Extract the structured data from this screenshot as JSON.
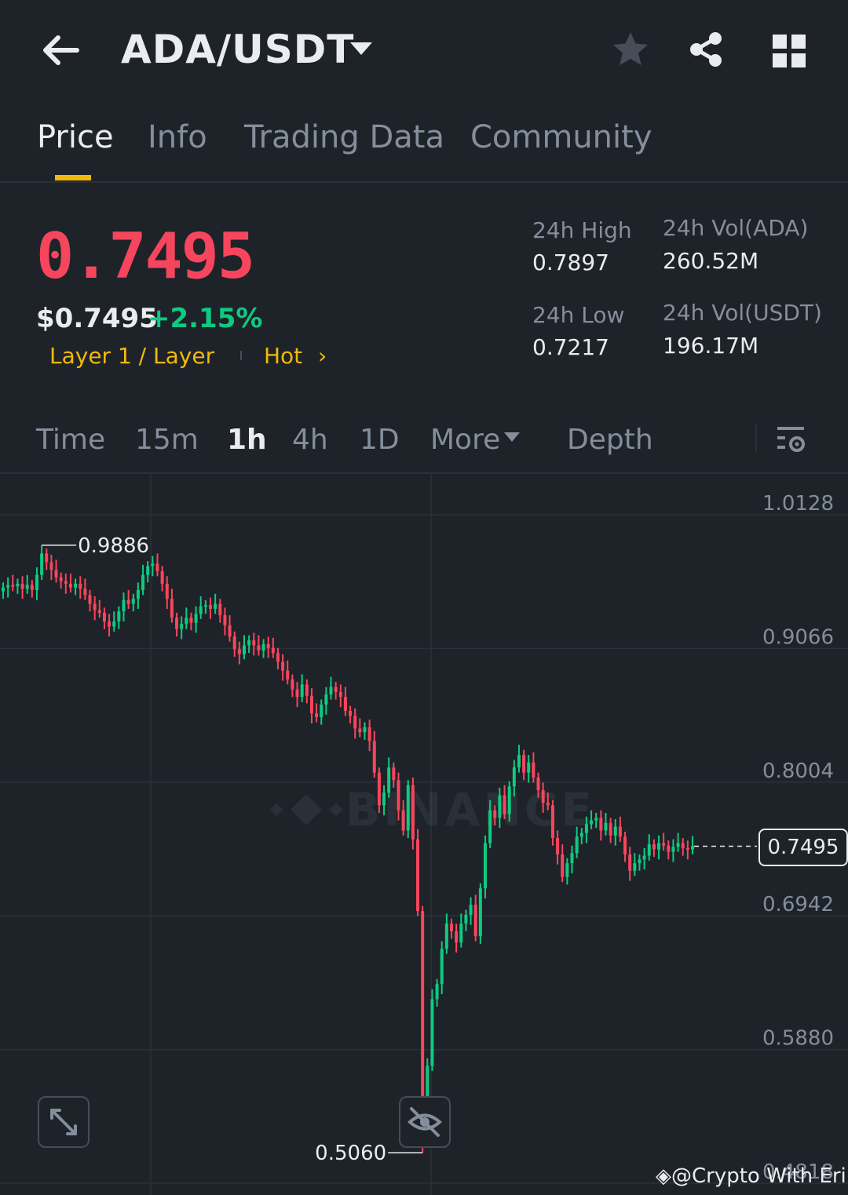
{
  "header": {
    "pair": "ADA/USDT",
    "icons": {
      "back": "arrow-left-icon",
      "favorite": "star-icon",
      "share": "share-icon",
      "layout": "grid-icon",
      "dropdown": "caret-down-icon"
    }
  },
  "tabs": [
    {
      "label": "Price",
      "active": true
    },
    {
      "label": "Info",
      "active": false
    },
    {
      "label": "Trading Data",
      "active": false
    },
    {
      "label": "Community",
      "active": false
    }
  ],
  "ticker": {
    "last_price": "0.7495",
    "usd_price": "$0.7495",
    "change": "+2.15%",
    "tag_category": "Layer 1 / Layer",
    "tag_hot": "Hot",
    "tag_arrow": "›",
    "high_label": "24h High",
    "high_value": "0.7897",
    "low_label": "24h Low",
    "low_value": "0.7217",
    "vol_base_label": "24h Vol(ADA)",
    "vol_base_value": "260.52M",
    "vol_quote_label": "24h Vol(USDT)",
    "vol_quote_value": "196.17M"
  },
  "intervals": {
    "time": "Time",
    "m15": "15m",
    "h1": "1h",
    "h4": "4h",
    "d1": "1D",
    "more": "More",
    "depth": "Depth",
    "active": "1h"
  },
  "chart_data": {
    "type": "candlestick",
    "watermark": "BINANCE",
    "y_ticks": [
      "1.0128",
      "0.9066",
      "0.8004",
      "0.6942",
      "0.5880",
      "0.4818"
    ],
    "ylim": [
      0.4818,
      1.0128
    ],
    "current_price": "0.7495",
    "annotations": {
      "high": "0.9886",
      "low": "0.5060"
    },
    "colors": {
      "up": "#0ecb81",
      "down": "#f6465d",
      "grid": "#2b3139",
      "axis_text": "#848e9c"
    },
    "closes": [
      0.955,
      0.957,
      0.956,
      0.958,
      0.954,
      0.957,
      0.953,
      0.965,
      0.982,
      0.975,
      0.969,
      0.963,
      0.96,
      0.958,
      0.955,
      0.958,
      0.954,
      0.949,
      0.942,
      0.937,
      0.935,
      0.928,
      0.924,
      0.928,
      0.936,
      0.945,
      0.942,
      0.946,
      0.953,
      0.965,
      0.972,
      0.974,
      0.968,
      0.958,
      0.946,
      0.931,
      0.922,
      0.926,
      0.931,
      0.927,
      0.934,
      0.94,
      0.941,
      0.938,
      0.942,
      0.933,
      0.925,
      0.916,
      0.906,
      0.902,
      0.909,
      0.913,
      0.909,
      0.905,
      0.91,
      0.907,
      0.903,
      0.896,
      0.889,
      0.882,
      0.874,
      0.868,
      0.878,
      0.869,
      0.855,
      0.852,
      0.862,
      0.87,
      0.876,
      0.872,
      0.868,
      0.857,
      0.853,
      0.843,
      0.84,
      0.844,
      0.833,
      0.808,
      0.782,
      0.792,
      0.812,
      0.802,
      0.778,
      0.762,
      0.798,
      0.755,
      0.698,
      0.538,
      0.575,
      0.628,
      0.64,
      0.668,
      0.688,
      0.682,
      0.673,
      0.688,
      0.695,
      0.703,
      0.678,
      0.716,
      0.752,
      0.778,
      0.772,
      0.79,
      0.775,
      0.797,
      0.812,
      0.822,
      0.808,
      0.816,
      0.804,
      0.794,
      0.784,
      0.782,
      0.756,
      0.743,
      0.725,
      0.736,
      0.744,
      0.757,
      0.76,
      0.767,
      0.77,
      0.772,
      0.762,
      0.768,
      0.758,
      0.765,
      0.757,
      0.743,
      0.73,
      0.736,
      0.739,
      0.742,
      0.751,
      0.747,
      0.752,
      0.75,
      0.745,
      0.749,
      0.752,
      0.748,
      0.747,
      0.7495
    ]
  },
  "controls": {
    "expand": "expand-icon",
    "hide_indicators": "eye-off-icon"
  },
  "watermark_text": "@Crypto With Erik"
}
